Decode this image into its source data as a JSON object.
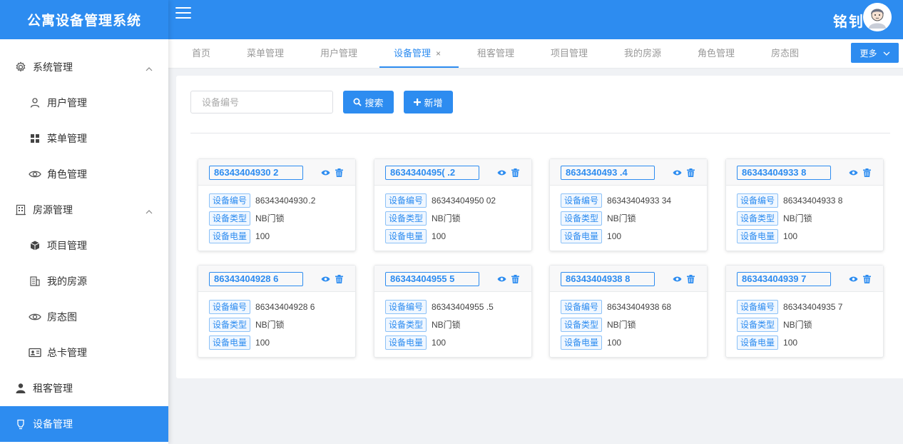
{
  "app": {
    "title": "公寓设备管理系统"
  },
  "user": {
    "name": "铭钊"
  },
  "sidebar": {
    "items": [
      {
        "label": "系统管理",
        "icon": "gear-icon",
        "sub": false,
        "expand": true
      },
      {
        "label": "用户管理",
        "icon": "user-icon",
        "sub": true
      },
      {
        "label": "菜单管理",
        "icon": "grid-icon",
        "sub": true
      },
      {
        "label": "角色管理",
        "icon": "eye-icon",
        "sub": true
      },
      {
        "label": "房源管理",
        "icon": "building-icon",
        "sub": false,
        "expand": true
      },
      {
        "label": "项目管理",
        "icon": "cube-icon",
        "sub": true
      },
      {
        "label": "我的房源",
        "icon": "building-icon",
        "sub": true
      },
      {
        "label": "房态图",
        "icon": "eye-icon",
        "sub": true
      },
      {
        "label": "总卡管理",
        "icon": "id-card-icon",
        "sub": true
      },
      {
        "label": "租客管理",
        "icon": "person-icon",
        "sub": false
      },
      {
        "label": "设备管理",
        "icon": "lightbulb-icon",
        "sub": false,
        "active": true
      }
    ]
  },
  "tabs": [
    {
      "label": "首页"
    },
    {
      "label": "菜单管理"
    },
    {
      "label": "用户管理"
    },
    {
      "label": "设备管理",
      "active": true,
      "close": "×"
    },
    {
      "label": "租客管理"
    },
    {
      "label": "项目管理"
    },
    {
      "label": "我的房源"
    },
    {
      "label": "角色管理"
    },
    {
      "label": "房态图"
    }
  ],
  "more_label": "更多",
  "search": {
    "placeholder": "设备编号",
    "value": ""
  },
  "buttons": {
    "search": "搜索",
    "add": "新增"
  },
  "field_labels": {
    "code": "设备编号",
    "type": "设备类型",
    "power": "设备电量"
  },
  "colors": {
    "primary": "#2d8cf0"
  },
  "devices": [
    {
      "title": "86343404930   2",
      "code": "86343404930 .2",
      "type": "NB门锁",
      "power": "100"
    },
    {
      "title": "8634340495(  .2",
      "code": "86343404950  02",
      "type": "NB门锁",
      "power": "100"
    },
    {
      "title": "8634340493   .4",
      "code": "86343404933  34",
      "type": "NB门锁",
      "power": "100"
    },
    {
      "title": "86343404933  8",
      "code": "86343404933  8",
      "type": "NB门锁",
      "power": "100"
    },
    {
      "title": "86343404928   6",
      "code": "86343404928  6",
      "type": "NB门锁",
      "power": "100"
    },
    {
      "title": "86343404955  5",
      "code": "86343404955  .5",
      "type": "NB门锁",
      "power": "100"
    },
    {
      "title": "86343404938  8",
      "code": "86343404938  68",
      "type": "NB门锁",
      "power": "100"
    },
    {
      "title": "86343404939  7",
      "code": "86343404935  7",
      "type": "NB门锁",
      "power": "100"
    }
  ]
}
